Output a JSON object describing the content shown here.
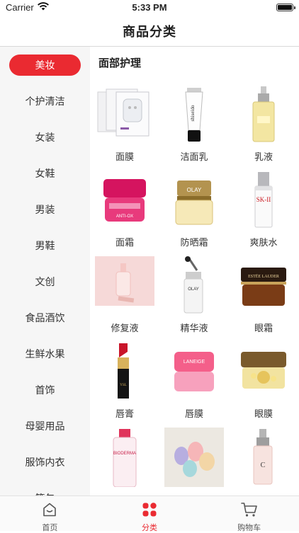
{
  "status": {
    "carrier": "Carrier",
    "time": "5:33 PM"
  },
  "nav": {
    "title": "商品分类"
  },
  "sidebar": {
    "active_index": 0,
    "items": [
      {
        "label": "美妆"
      },
      {
        "label": "个护清洁"
      },
      {
        "label": "女装"
      },
      {
        "label": "女鞋"
      },
      {
        "label": "男装"
      },
      {
        "label": "男鞋"
      },
      {
        "label": "文创"
      },
      {
        "label": "食品酒饮"
      },
      {
        "label": "生鲜水果"
      },
      {
        "label": "首饰"
      },
      {
        "label": "母婴用品"
      },
      {
        "label": "服饰内衣"
      },
      {
        "label": "箱包"
      }
    ]
  },
  "main": {
    "section_title": "面部护理",
    "products": [
      {
        "label": "面膜",
        "image": "facial-mask-box"
      },
      {
        "label": "洁面乳",
        "image": "cleanser-tube"
      },
      {
        "label": "乳液",
        "image": "lotion-bottle"
      },
      {
        "label": "面霜",
        "image": "pink-cream-jar"
      },
      {
        "label": "防晒霜",
        "image": "olay-gold-jar"
      },
      {
        "label": "爽肤水",
        "image": "toner-bottle"
      },
      {
        "label": "修复液",
        "image": "pink-serum-bottle"
      },
      {
        "label": "精华液",
        "image": "dropper-serum"
      },
      {
        "label": "眼霜",
        "image": "bronze-eye-cream-jar"
      },
      {
        "label": "唇膏",
        "image": "lipstick"
      },
      {
        "label": "唇膜",
        "image": "pink-lip-mask-jar"
      },
      {
        "label": "眼膜",
        "image": "eye-mask-jar"
      },
      {
        "label": "",
        "image": "micellar-water-bottle"
      },
      {
        "label": "",
        "image": "makeup-sponges"
      },
      {
        "label": "",
        "image": "clinique-bottle"
      }
    ]
  },
  "tabs": [
    {
      "label": "首页",
      "icon": "home-icon"
    },
    {
      "label": "分类",
      "icon": "category-icon"
    },
    {
      "label": "购物车",
      "icon": "cart-icon"
    }
  ],
  "colors": {
    "accent": "#ea2a31",
    "sidebar_bg": "#f6f6f6"
  }
}
